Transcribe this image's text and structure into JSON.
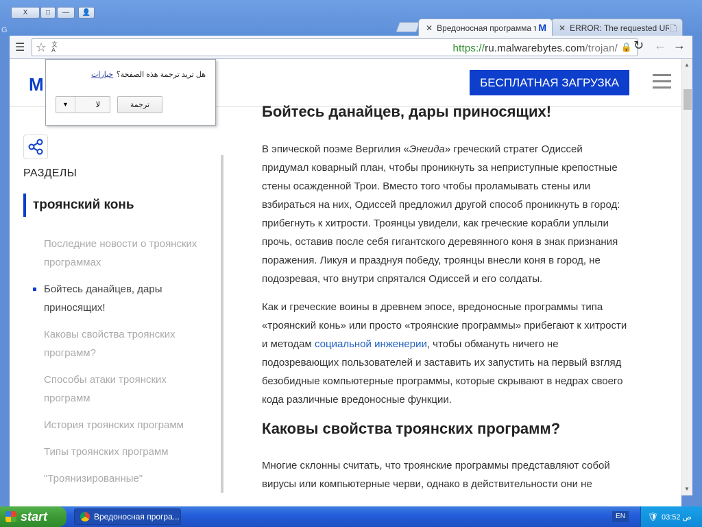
{
  "window": {
    "controls": [
      "X",
      "□",
      "—",
      "👤"
    ]
  },
  "tabs": [
    {
      "title": "Вредоносная программа ти",
      "active": true
    },
    {
      "title": "ERROR: The requested URL",
      "active": false
    }
  ],
  "address_bar": {
    "scheme": "https://",
    "host": "ru.malwarebytes.com",
    "path": "/trojan/"
  },
  "translate_bubble": {
    "question": "هل تريد ترجمة هذه الصفحة؟",
    "options_link": "خيارات",
    "decline_value": "لا",
    "translate_button": "ترجمة"
  },
  "site": {
    "logo": "M",
    "download_button": "БЕСПЛАТНАЯ ЗАГРУЗКА",
    "brand_color": "#0d3ecc"
  },
  "sidebar": {
    "heading": "РАЗДЕЛЫ",
    "current": "троянский конь",
    "items": [
      "Последние новости о троянских программах",
      "Бойтесь данайцев, дары приносящих!",
      "Каковы свойства троянских программ?",
      "Способы атаки троянских программ",
      "История троянских программ",
      "Типы троянских программ",
      "\"Троянизированные\""
    ],
    "active_index": 1
  },
  "article": {
    "heading1": "Бойтесь данайцев, дары приносящих!",
    "para1_before": "В эпической поэме Вергилия «",
    "para1_em": "Энеида",
    "para1_after": "» греческий стратег Одиссей придумал коварный план, чтобы проникнуть за неприступные крепостные стены осажденной Трои. Вместо того чтобы проламывать стены или взбираться на них, Одиссей предложил другой способ проникнуть в город: прибегнуть к хитрости. Троянцы увидели, как греческие корабли уплыли прочь, оставив после себя гигантского деревянного коня в знак признания поражения. Ликуя и празднуя победу, троянцы внесли коня в город, не подозревая, что внутри спрятался Одиссей и его солдаты.",
    "para2_before": "Как и греческие воины в древнем эпосе, вредоносные программы типа «троянский конь» или просто «троянские программы» прибегают к хитрости и методам ",
    "para2_link": "социальной инженерии",
    "para2_after": ", чтобы обмануть ничего не подозревающих пользователей и заставить их запустить на первый взгляд безобидные компьютерные программы, которые скрывают в недрах своего кода различные вредоносные функции.",
    "heading2": "Каковы свойства троянских программ?",
    "para3": "Многие склонны считать, что троянские программы представляют собой вирусы или компьютерные черви, однако в действительности они не"
  },
  "taskbar": {
    "start_label": "start",
    "task_title": "Вредоносная програ...",
    "language": "EN",
    "time": "03:52 ص"
  }
}
